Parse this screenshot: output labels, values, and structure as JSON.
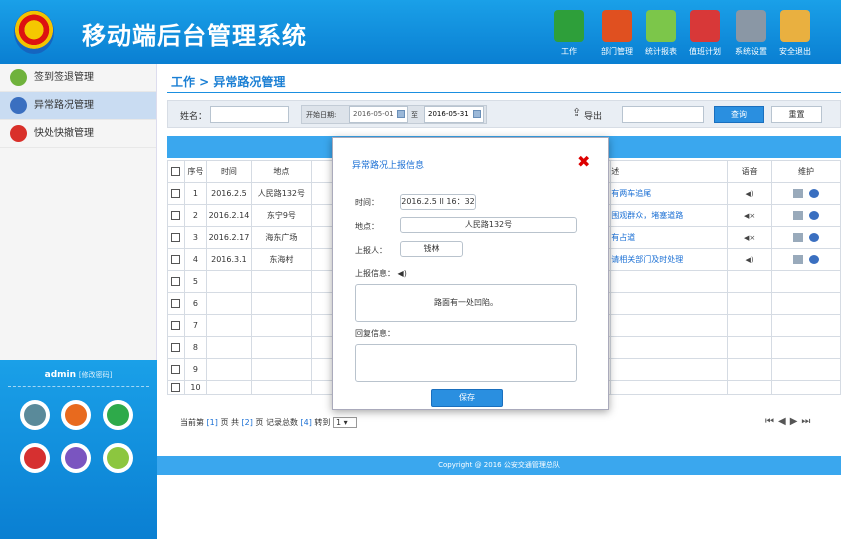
{
  "header": {
    "title": "移动端后台管理系统"
  },
  "topnav": [
    {
      "label": "工作",
      "icon": "book-icon",
      "color": "#2e9f3a"
    },
    {
      "label": "部门管理",
      "icon": "people-icon",
      "color": "#e05020"
    },
    {
      "label": "统计报表",
      "icon": "report-icon",
      "color": "#7cc64a"
    },
    {
      "label": "值班计划",
      "icon": "calendar-icon",
      "color": "#d83838"
    },
    {
      "label": "系统设置",
      "icon": "tools-icon",
      "color": "#8a97a5"
    },
    {
      "label": "安全退出",
      "icon": "exit-door-icon",
      "color": "#e9b040"
    }
  ],
  "sidebar": {
    "items": [
      {
        "label": "签到签退管理",
        "icon": "user-checkin-icon",
        "color": "#6fb23c"
      },
      {
        "label": "异常路况管理",
        "icon": "traffic-warning-icon",
        "color": "#3a6fc0"
      },
      {
        "label": "快处快撤管理",
        "icon": "mail-icon",
        "color": "#d9302a"
      }
    ]
  },
  "user": {
    "name": "admin",
    "edit": "[修改密码]"
  },
  "apps": [
    {
      "icon": "pen-app-icon",
      "color": "#5a8a9a"
    },
    {
      "icon": "firefox-app-icon",
      "color": "#e86a1e"
    },
    {
      "icon": "drive-app-icon",
      "color": "#2eaa4a"
    },
    {
      "icon": "gmail-app-icon",
      "color": "#d63030"
    },
    {
      "icon": "chrome-app-icon",
      "color": "#7a55c0"
    },
    {
      "icon": "android-app-icon",
      "color": "#8cc63f"
    }
  ],
  "breadcrumb": "工作 > 异常路况管理",
  "filter": {
    "name_label": "姓名：",
    "date_label": "开始日期:",
    "date_from": "2016-05-01",
    "to": "至",
    "date_to": "2016-05-31",
    "export": "导出",
    "search": "查询",
    "reset": "重置"
  },
  "table": {
    "headers": [
      "序号",
      "时间",
      "地点",
      "述",
      "语音",
      "维护"
    ],
    "rows": [
      {
        "no": "1",
        "time": "2016.2.5",
        "place": "人民路132号",
        "desc": "有两车追尾",
        "voice": "speaker-icon"
      },
      {
        "no": "2",
        "time": "2016.2.14",
        "place": "东宁9号",
        "desc": "围观群众，堵塞道路",
        "voice": "mute-icon"
      },
      {
        "no": "3",
        "time": "2016.2.17",
        "place": "海东广场",
        "desc": "有占道",
        "voice": "mute-icon"
      },
      {
        "no": "4",
        "time": "2016.3.1",
        "place": "东海村",
        "desc": "请相关部门及时处理",
        "voice": "speaker-icon"
      },
      {
        "no": "5"
      },
      {
        "no": "6"
      },
      {
        "no": "7"
      },
      {
        "no": "8"
      },
      {
        "no": "9"
      },
      {
        "no": "10"
      }
    ]
  },
  "pager": {
    "t1": "当前第",
    "cur": "[1]",
    "t2": "页 共",
    "total": "[2]",
    "t3": "页 记录总数",
    "count": "[4]",
    "t4": "转到",
    "sel": "1"
  },
  "footer": "Copyright @ 2016 公安交通管理总队",
  "modal": {
    "title": "异常路况上报信息",
    "time_label": "时间：",
    "time": "2016.2.5 ll 16：32",
    "place_label": "地点：",
    "place": "人民路132号",
    "reporter_label": "上报人：",
    "reporter": "钱林",
    "info_label": "上报信息：",
    "info": "路面有一处凹陷。",
    "reply_label": "回复信息：",
    "save": "保存"
  }
}
